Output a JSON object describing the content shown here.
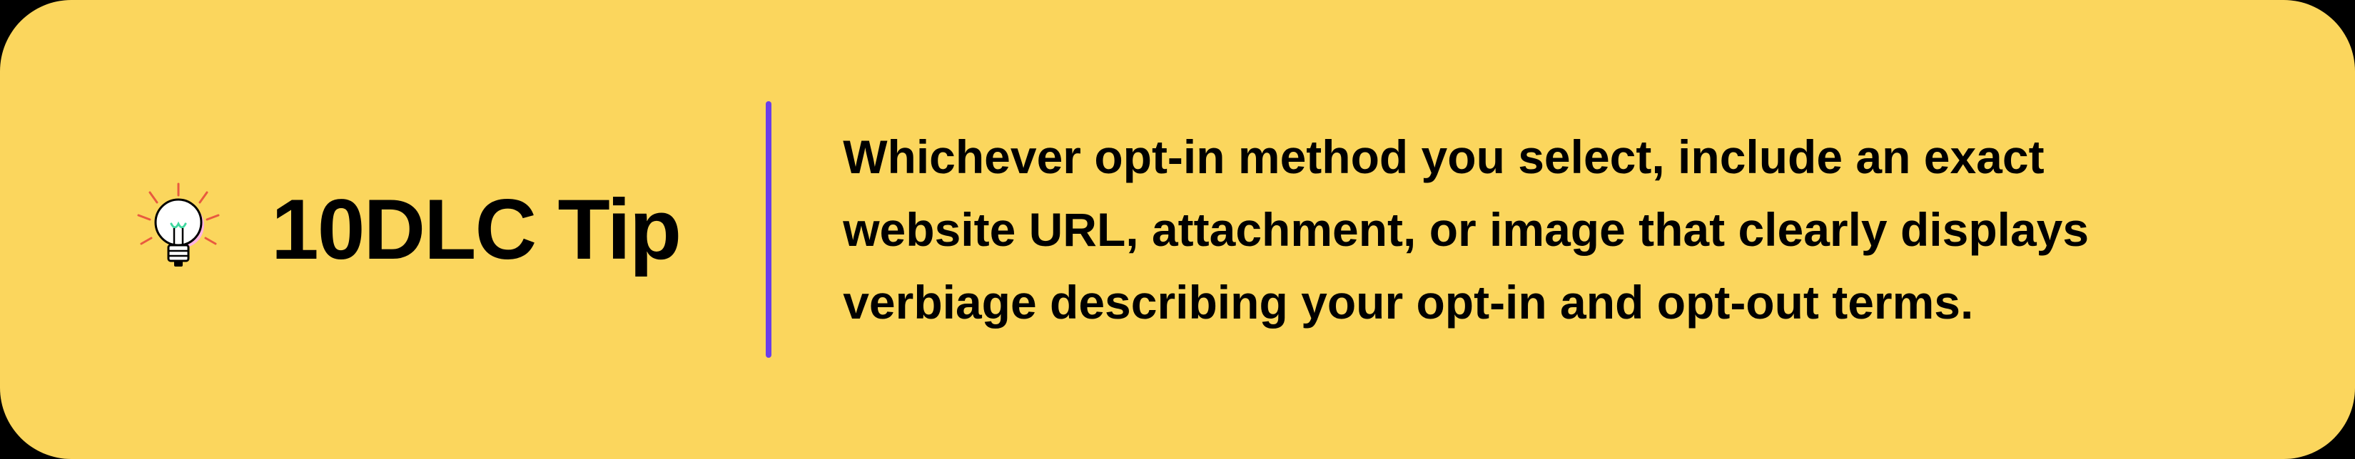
{
  "tip": {
    "title": "10DLC Tip",
    "body": "Whichever opt-in method you select, include an exact website URL, attachment, or image that clearly displays verbiage describing your opt-in and opt-out terms.",
    "icon": "lightbulb-icon",
    "colors": {
      "background": "#FBD65D",
      "divider": "#6B3FE8",
      "text": "#000000",
      "ray": "#E85A3F"
    }
  }
}
